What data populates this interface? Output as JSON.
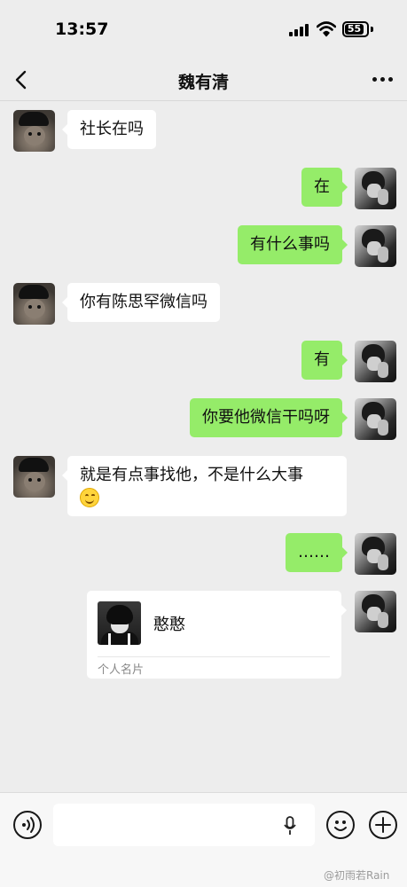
{
  "status_bar": {
    "time": "13:57",
    "battery": "55"
  },
  "nav": {
    "title": "魏有清",
    "back_icon": "chevron-left-icon",
    "more_icon": "ellipsis-icon"
  },
  "messages": [
    {
      "side": "in",
      "text": "社长在吗"
    },
    {
      "side": "out",
      "text": "在"
    },
    {
      "side": "out",
      "text": "有什么事吗"
    },
    {
      "side": "in",
      "text": "你有陈思罕微信吗"
    },
    {
      "side": "out",
      "text": "有"
    },
    {
      "side": "out",
      "text": "你要他微信干吗呀"
    },
    {
      "side": "in",
      "text": "就是有点事找他，不是什么大事",
      "emoji": "smile-emoji"
    },
    {
      "side": "out",
      "text": "……"
    }
  ],
  "contact_card": {
    "name": "憨憨",
    "type": "个人名片"
  },
  "input_bar": {
    "voice_icon": "voice-icon",
    "mic_icon": "mic-icon",
    "emoji_icon": "emoji-icon",
    "plus_icon": "plus-icon"
  },
  "watermark": "@初雨若Rain",
  "colors": {
    "background": "#ededed",
    "outgoing_bubble": "#95ec69",
    "incoming_bubble": "#ffffff"
  }
}
